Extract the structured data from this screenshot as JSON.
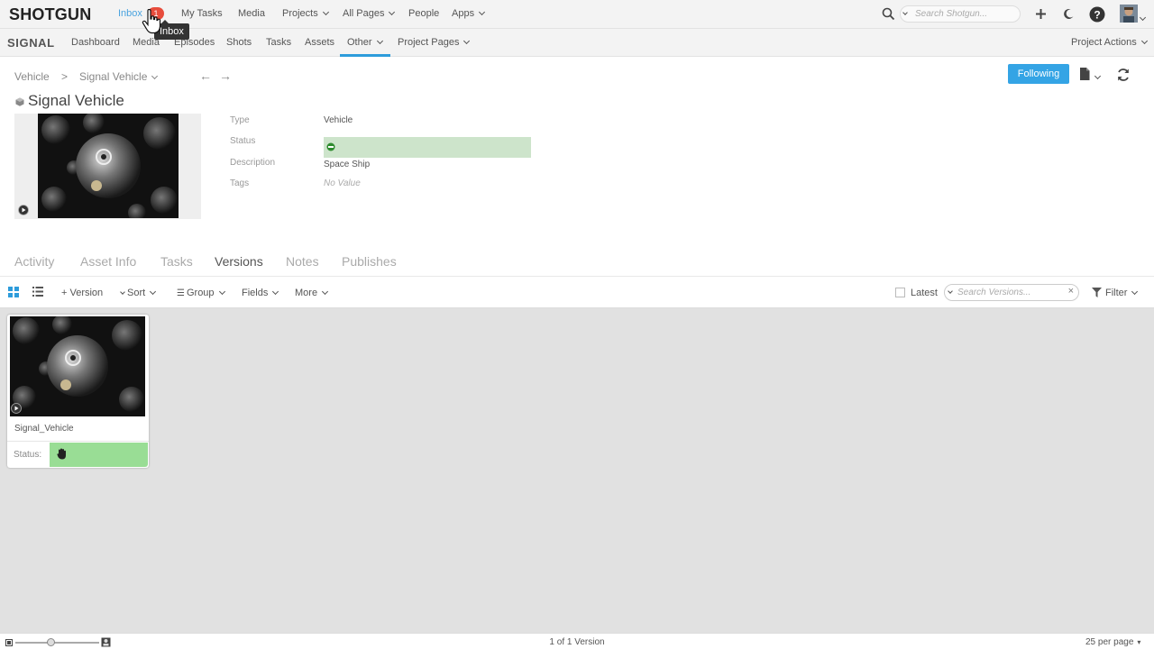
{
  "topbar": {
    "logo": "SHOTGUN",
    "nav": {
      "inbox": "Inbox",
      "inbox_badge": "1",
      "my_tasks": "My Tasks",
      "media": "Media",
      "projects": "Projects",
      "all_pages": "All Pages",
      "people": "People",
      "apps": "Apps"
    },
    "tooltip": "Inbox",
    "search_placeholder": "Search Shotgun..."
  },
  "project_bar": {
    "name": "SIGNAL",
    "items": {
      "dashboard": "Dashboard",
      "media": "Media",
      "episodes": "Episodes",
      "shots": "Shots",
      "tasks": "Tasks",
      "assets": "Assets",
      "other": "Other",
      "project_pages": "Project Pages",
      "project_actions": "Project Actions"
    }
  },
  "breadcrumb": {
    "parent": "Vehicle",
    "separator": ">",
    "current": "Signal Vehicle",
    "prev_arrow": "←",
    "next_arrow": "→"
  },
  "header": {
    "title": "Signal Vehicle",
    "following_button": "Following"
  },
  "fields": {
    "type_label": "Type",
    "type_value": "Vehicle",
    "status_label": "Status",
    "description_label": "Description",
    "description_value": "Space Ship",
    "tags_label": "Tags",
    "tags_value": "No Value"
  },
  "tabs": {
    "activity": "Activity",
    "asset_info": "Asset Info",
    "tasks": "Tasks",
    "versions": "Versions",
    "notes": "Notes",
    "publishes": "Publishes"
  },
  "toolbar": {
    "add_version": "+ Version",
    "sort": "Sort",
    "group": "Group",
    "fields": "Fields",
    "more": "More",
    "latest": "Latest",
    "search_placeholder": "Search Versions...",
    "filter": "Filter"
  },
  "versions": [
    {
      "name": "Signal_Vehicle",
      "status_label": "Status:"
    }
  ],
  "footer": {
    "count": "1 of 1 Version",
    "per_page": "25 per page"
  },
  "colors": {
    "accent": "#2d9cdb",
    "following_bg": "#34a4e5",
    "badge": "#e74c3c",
    "status_green_light": "#cde4cb",
    "status_green": "#99dd95"
  }
}
